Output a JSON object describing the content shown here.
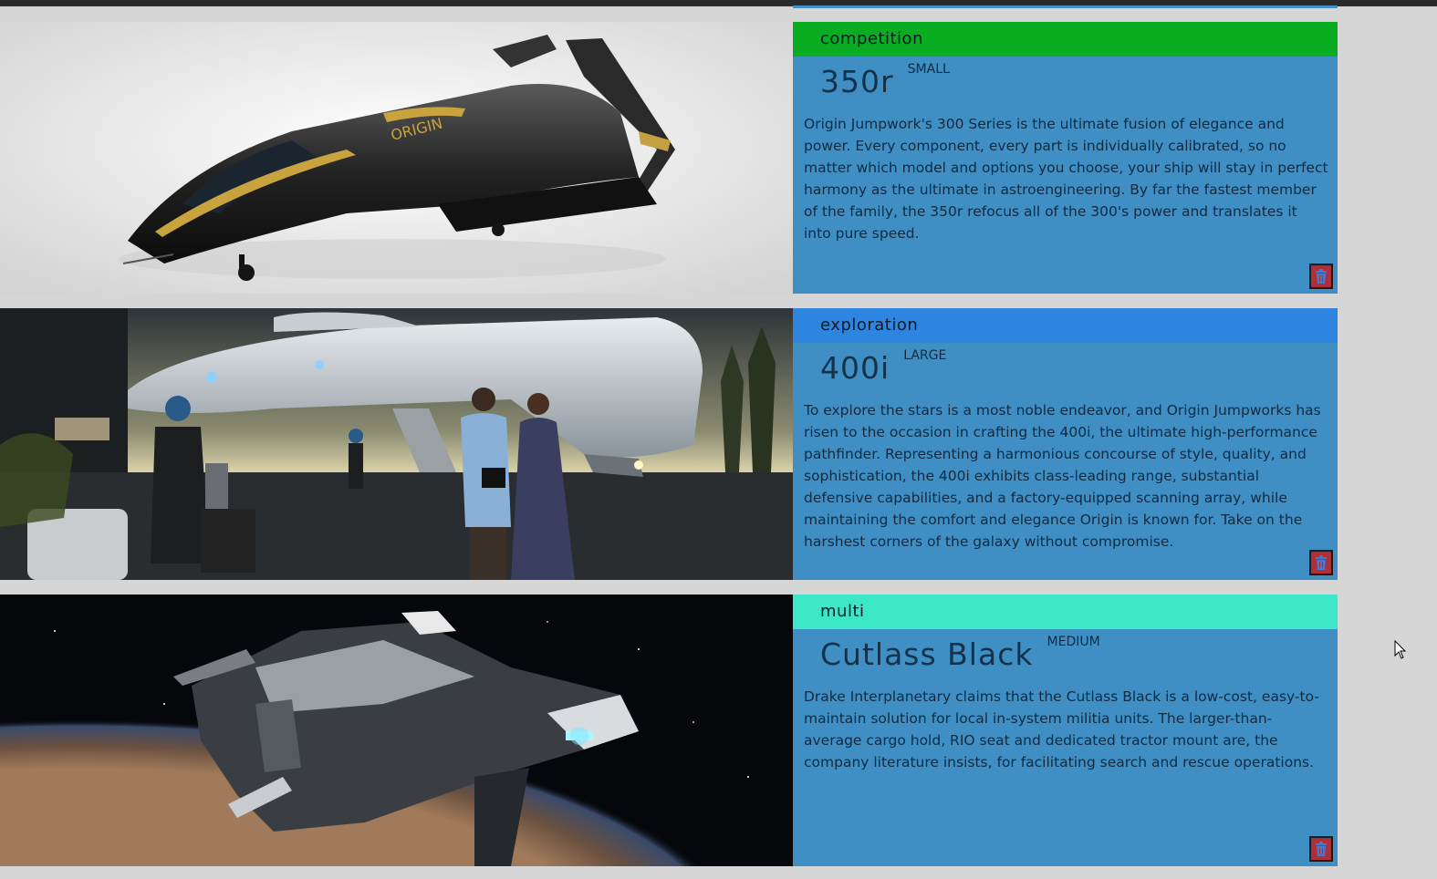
{
  "ships": [
    {
      "category": "competition",
      "category_color": "#0aad22",
      "name": "350r",
      "size": "SMALL",
      "description": "Origin Jumpwork's 300 Series is the ultimate fusion of elegance and power. Every component, every part is individually calibrated, so no matter which model and options you choose, your ship will stay in perfect harmony as the ultimate in astroengineering. By far the fastest member of the family, the 350r refocus all of the 300's power and translates it into pure speed.",
      "delete_icon": "trash-icon"
    },
    {
      "category": "exploration",
      "category_color": "#2e85e0",
      "name": "400i",
      "size": "LARGE",
      "description": "To explore the stars is a most noble endeavor, and Origin Jumpworks has risen to the occasion in crafting the 400i, the ultimate high-performance pathfinder. Representing a harmonious concourse of style, quality, and sophistication, the 400i exhibits class-leading range, substantial defensive capabilities, and a factory-equipped scanning array, while maintaining the comfort and elegance Origin is known for. Take on the harshest corners of the galaxy without compromise.",
      "delete_icon": "trash-icon"
    },
    {
      "category": "multi",
      "category_color": "#3de8c8",
      "name": "Cutlass Black",
      "size": "MEDIUM",
      "description": "Drake Interplanetary claims that the Cutlass Black is a low-cost, easy-to-maintain solution for local in-system militia units. The larger-than-average cargo hold, RIO seat and dedicated tractor mount are, the company literature insists, for facilitating search and rescue operations.",
      "delete_icon": "trash-icon"
    }
  ],
  "colors": {
    "info_panel": "#3f8fc4",
    "delete_button": "#b0303a"
  }
}
